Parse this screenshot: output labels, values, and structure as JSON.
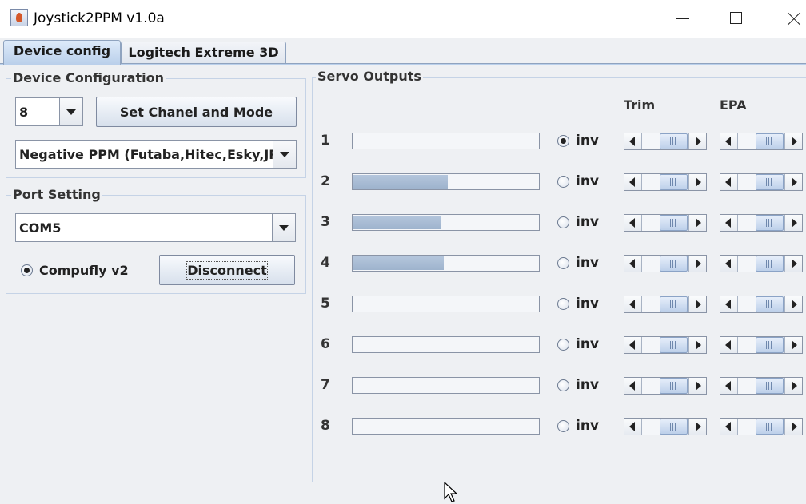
{
  "window": {
    "title": "Joystick2PPM v1.0a"
  },
  "tabs": [
    {
      "label": "Device config"
    },
    {
      "label": "Logitech Extreme 3D"
    }
  ],
  "device_config": {
    "title": "Device Configuration",
    "channel_select": "8",
    "set_button": "Set Chanel and Mode",
    "mode_select": "Negative PPM (Futaba,Hitec,Esky,JR)"
  },
  "port_setting": {
    "title": "Port Setting",
    "port_select": "COM5",
    "device_radio": "Compufly v2",
    "device_radio_selected": true,
    "disconnect_button": "Disconnect"
  },
  "servo_outputs": {
    "title": "Servo Outputs",
    "trim_label": "Trim",
    "epa_label": "EPA",
    "inv_label": "inv",
    "channels": [
      {
        "num": "1",
        "level_percent": 0,
        "inv": true
      },
      {
        "num": "2",
        "level_percent": 51,
        "inv": false
      },
      {
        "num": "3",
        "level_percent": 47,
        "inv": false
      },
      {
        "num": "4",
        "level_percent": 49,
        "inv": false
      },
      {
        "num": "5",
        "level_percent": 0,
        "inv": false
      },
      {
        "num": "6",
        "level_percent": 0,
        "inv": false
      },
      {
        "num": "7",
        "level_percent": 0,
        "inv": false
      },
      {
        "num": "8",
        "level_percent": 0,
        "inv": false
      }
    ]
  }
}
